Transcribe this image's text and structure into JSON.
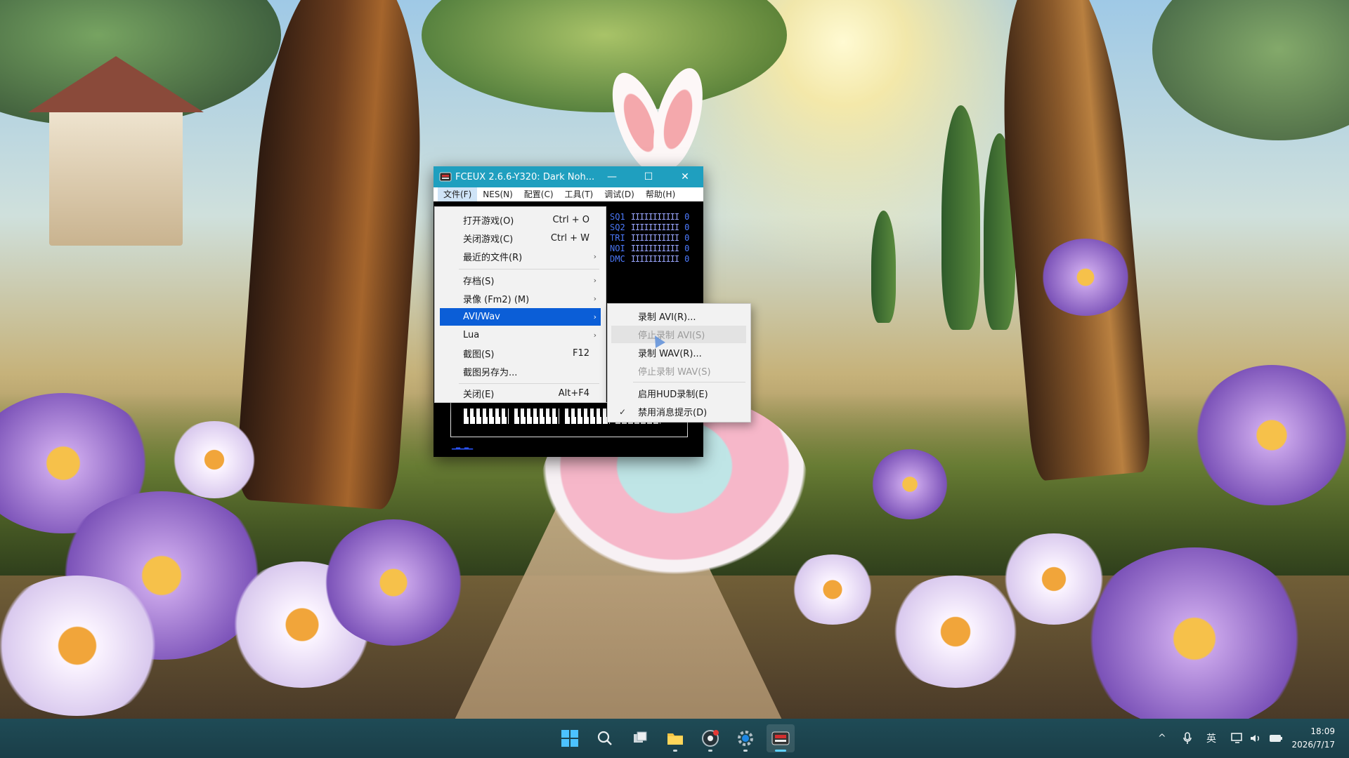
{
  "window": {
    "title": "FCEUX 2.6.6-Y320: Dark Noh...",
    "controls": {
      "minimize": "—",
      "maximize": "☐",
      "close": "✕"
    },
    "menubar": [
      "文件(F)",
      "NES(N)",
      "配置(C)",
      "工具(T)",
      "调试(D)",
      "帮助(H)"
    ]
  },
  "sound_channels": [
    {
      "name": "SQ1",
      "bars": "IIIIIIIIIII",
      "value": "0"
    },
    {
      "name": "SQ2",
      "bars": "IIIIIIIIIII",
      "value": "0"
    },
    {
      "name": "TRI",
      "bars": "IIIIIIIIIII",
      "value": "0"
    },
    {
      "name": "NOI",
      "bars": "IIIIIIIIIII",
      "value": "0"
    },
    {
      "name": "DMC",
      "bars": "IIIIIIIIIII",
      "value": "0"
    }
  ],
  "file_menu": {
    "open_game": {
      "label": "打开游戏(O)",
      "shortcut": "Ctrl + O"
    },
    "close_game": {
      "label": "关闭游戏(C)",
      "shortcut": "Ctrl + W"
    },
    "recent_files": {
      "label": "最近的文件(R)"
    },
    "savestate": {
      "label": "存档(S)"
    },
    "movie": {
      "label": "录像 (Fm2) (M)"
    },
    "avi_wav": {
      "label": "AVI/Wav"
    },
    "lua": {
      "label": "Lua"
    },
    "screenshot": {
      "label": "截图(S)",
      "shortcut": "F12"
    },
    "screenshot_as": {
      "label": "截图另存为..."
    },
    "exit": {
      "label": "关闭(E)",
      "shortcut": "Alt+F4"
    },
    "submenu_arrow": "›"
  },
  "avi_submenu": {
    "record_avi": "录制 AVI(R)...",
    "stop_avi": "停止录制 AVI(S)",
    "record_wav": "录制 WAV(R)...",
    "stop_wav": "停止录制 WAV(S)",
    "enable_hud": "启用HUD录制(E)",
    "disable_msgs": "禁用消息提示(D)",
    "check_mark": "✓"
  },
  "taskbar": {
    "tray_chevron": "^",
    "ime": "英",
    "time": "18:09",
    "date": "2026/7/17"
  },
  "icons": {
    "start": "windows-start-icon",
    "search": "search-icon",
    "task_view": "task-view-icon",
    "explorer": "file-explorer-icon",
    "media": "media-player-icon",
    "settings": "settings-gear-icon",
    "fceux": "fceux-icon"
  },
  "colors": {
    "titlebar": "#1f9fbf",
    "menu_highlight": "#0b5ed7",
    "taskbar": "#1f4b56",
    "accent": "#4cc2ff"
  }
}
